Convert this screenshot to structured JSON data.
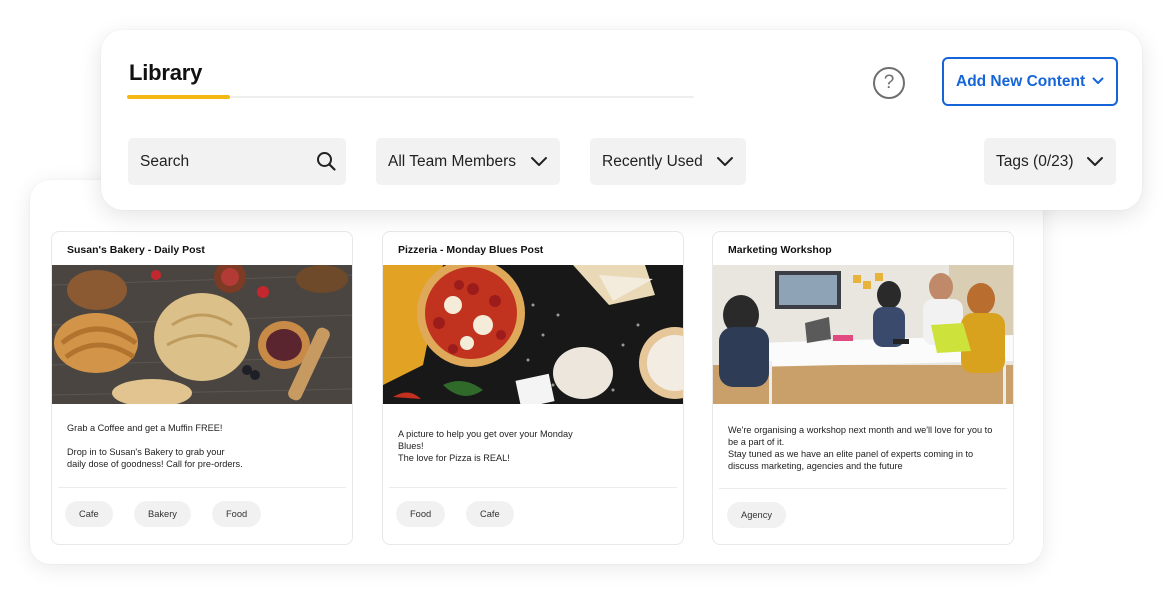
{
  "library": {
    "title": "Library",
    "add_button_label": "Add New Content",
    "help_label": "?",
    "accent_color": "#f5b712",
    "primary_color": "#1565d8"
  },
  "filters": {
    "search_placeholder": "Search",
    "team_members": "All Team Members",
    "sort": "Recently Used",
    "tags": "Tags (0/23)"
  },
  "cards": [
    {
      "title": "Susan's Bakery - Daily Post",
      "image": "bakery-photo",
      "body_lines": [
        "Grab a Coffee and get a Muffin FREE!",
        "",
        "Drop in to Susan's Bakery to grab your",
        "daily dose of goodness! Call for pre-orders."
      ],
      "tags": [
        "Cafe",
        "Bakery",
        "Food"
      ]
    },
    {
      "title": "Pizzeria - Monday Blues Post",
      "image": "pizza-photo",
      "body_lines": [
        "A picture to help you get over your Monday",
        "Blues!",
        "The love for Pizza is REAL!"
      ],
      "tags": [
        "Food",
        "Cafe"
      ]
    },
    {
      "title": "Marketing Workshop",
      "image": "workshop-photo",
      "body_lines": [
        "We're organising a workshop next month and we'll love for you to",
        "be a part of it.",
        "Stay tuned as we have an elite panel of experts coming in to",
        "discuss marketing, agencies and the future"
      ],
      "tags": [
        "Agency"
      ]
    }
  ]
}
